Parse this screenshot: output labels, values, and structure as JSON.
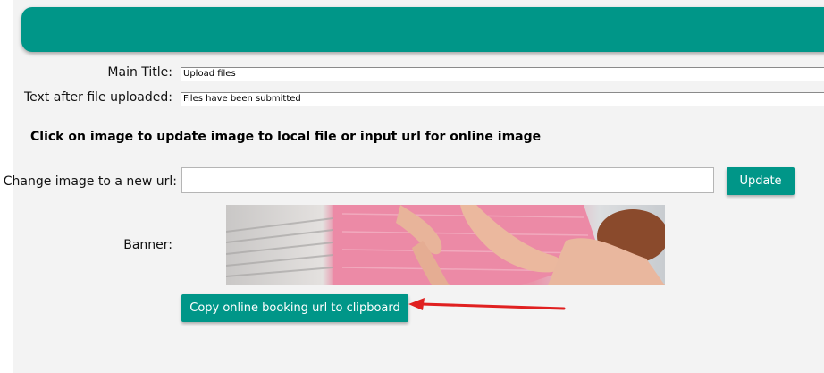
{
  "form": {
    "main_title_label": "Main Title:",
    "main_title_value": "Upload files",
    "after_upload_label": "Text after file uploaded:",
    "after_upload_value": "Files have been submitted",
    "instructions": "Click on image to update image to local file or input url for online image",
    "change_url_label": "Change image to a new url:",
    "change_url_value": "",
    "update_button": "Update",
    "banner_label": "Banner:",
    "copy_button": "Copy online booking url to clipboard"
  },
  "colors": {
    "accent": "#009688",
    "panel_bg": "#f3f3f3",
    "arrow": "#e02020"
  }
}
